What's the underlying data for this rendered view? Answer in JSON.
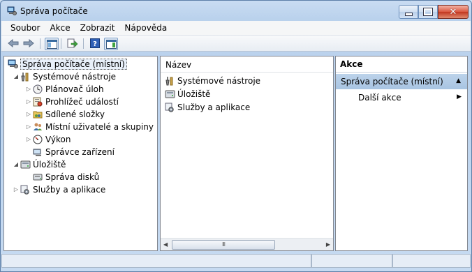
{
  "window": {
    "title": "Správa počítače"
  },
  "menu": [
    "Soubor",
    "Akce",
    "Zobrazit",
    "Nápověda"
  ],
  "toolbar": {
    "buttons": [
      "back-icon",
      "forward-icon",
      "show-hide-tree-icon",
      "export-list-icon",
      "help-icon",
      "show-hide-action-pane-icon"
    ]
  },
  "tree": {
    "root": "Správa počítače (místní)",
    "items": [
      {
        "label": "Systémové nástroje",
        "icon": "tools-icon",
        "expander": "◢",
        "level": 1
      },
      {
        "label": "Plánovač úloh",
        "icon": "clock-icon",
        "expander": "▷",
        "level": 2
      },
      {
        "label": "Prohlížeč událostí",
        "icon": "event-viewer-icon",
        "expander": "▷",
        "level": 2
      },
      {
        "label": "Sdílené složky",
        "icon": "shared-folder-icon",
        "expander": "▷",
        "level": 2
      },
      {
        "label": "Místní uživatelé a skupiny",
        "icon": "users-icon",
        "expander": "▷",
        "level": 2
      },
      {
        "label": "Výkon",
        "icon": "performance-icon",
        "expander": "▷",
        "level": 2
      },
      {
        "label": "Správce zařízení",
        "icon": "device-manager-icon",
        "expander": "",
        "level": 2
      },
      {
        "label": "Úložiště",
        "icon": "storage-icon",
        "expander": "◢",
        "level": 1
      },
      {
        "label": "Správa disků",
        "icon": "disk-icon",
        "expander": "",
        "level": 2
      },
      {
        "label": "Služby a aplikace",
        "icon": "services-icon",
        "expander": "▷",
        "level": 1
      }
    ]
  },
  "list": {
    "column": "Název",
    "rows": [
      {
        "label": "Systémové nástroje",
        "icon": "tools-icon"
      },
      {
        "label": "Úložiště",
        "icon": "storage-icon"
      },
      {
        "label": "Služby a aplikace",
        "icon": "services-icon"
      }
    ],
    "scroll_grip": "III"
  },
  "actions": {
    "header": "Akce",
    "group": "Správa počítače (místní)",
    "items": [
      "Další akce"
    ]
  }
}
